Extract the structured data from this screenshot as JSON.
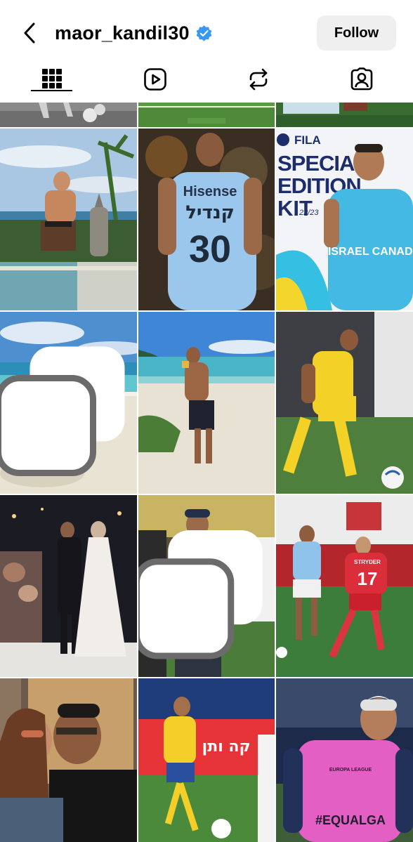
{
  "header": {
    "username": "maor_kandil30",
    "verified": true,
    "follow_label": "Follow",
    "accent": "#3897f0"
  },
  "tabs": [
    {
      "icon": "grid-icon",
      "selected": true
    },
    {
      "icon": "reels-icon",
      "selected": false
    },
    {
      "icon": "reposts-icon",
      "selected": false
    },
    {
      "icon": "tagged-icon",
      "selected": false
    }
  ],
  "posts": {
    "row2_right_logo": "FILA",
    "row2_right_title_1": "SPECIAL",
    "row2_right_title_2": "EDITION",
    "row2_right_title_3": "KIT",
    "row2_right_season": "22/23",
    "row2_right_shirt": "ISRAEL CANADA",
    "row2_mid_sponsor": "Hisense",
    "row2_mid_name": "קנדיל",
    "row2_mid_number": "30",
    "row4_right_number": "17",
    "row4_right_name": "STRYDER",
    "row5_mid_banner": "קה ותן אבל",
    "row5_right_shirt": "#EQUALGA",
    "row5_right_badge": "EUROPA LEAGUE"
  }
}
